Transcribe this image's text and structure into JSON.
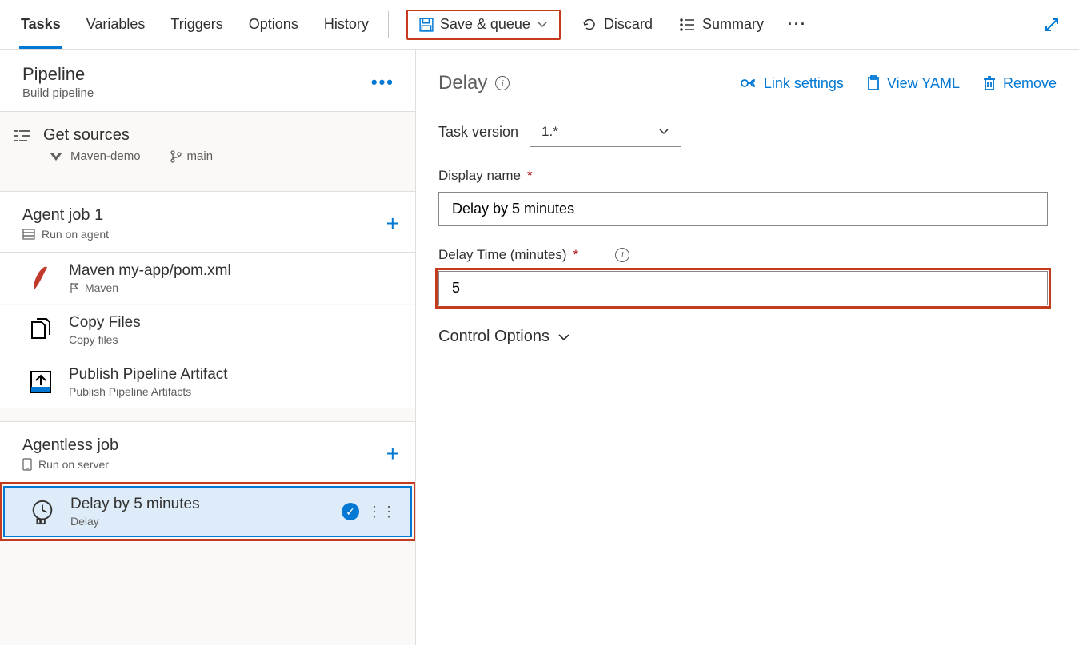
{
  "tabs": [
    "Tasks",
    "Variables",
    "Triggers",
    "Options",
    "History"
  ],
  "activeTab": 0,
  "topbar": {
    "save": "Save & queue",
    "discard": "Discard",
    "summary": "Summary"
  },
  "pipeline": {
    "title": "Pipeline",
    "subtitle": "Build pipeline"
  },
  "getSources": {
    "title": "Get sources",
    "repo": "Maven-demo",
    "branch": "main"
  },
  "jobs": [
    {
      "title": "Agent job 1",
      "subtitle": "Run on agent",
      "subIcon": "server-icon",
      "tasks": [
        {
          "name": "Maven my-app/pom.xml",
          "sub": "Maven",
          "subIcon": "flag-icon",
          "icon": "feather"
        },
        {
          "name": "Copy Files",
          "sub": "Copy files",
          "subIcon": "",
          "icon": "copy"
        },
        {
          "name": "Publish Pipeline Artifact",
          "sub": "Publish Pipeline Artifacts",
          "subIcon": "",
          "icon": "upload"
        }
      ]
    },
    {
      "title": "Agentless job",
      "subtitle": "Run on server",
      "subIcon": "server-icon",
      "tasks": [
        {
          "name": "Delay by 5 minutes",
          "sub": "Delay",
          "subIcon": "",
          "icon": "delay",
          "selected": true
        }
      ]
    }
  ],
  "detail": {
    "title": "Delay",
    "links": {
      "link": "Link settings",
      "yaml": "View YAML",
      "remove": "Remove"
    },
    "taskVersionLabel": "Task version",
    "taskVersion": "1.*",
    "displayNameLabel": "Display name",
    "displayName": "Delay by 5 minutes",
    "delayLabel": "Delay Time (minutes)",
    "delayValue": "5",
    "controlOptions": "Control Options"
  }
}
